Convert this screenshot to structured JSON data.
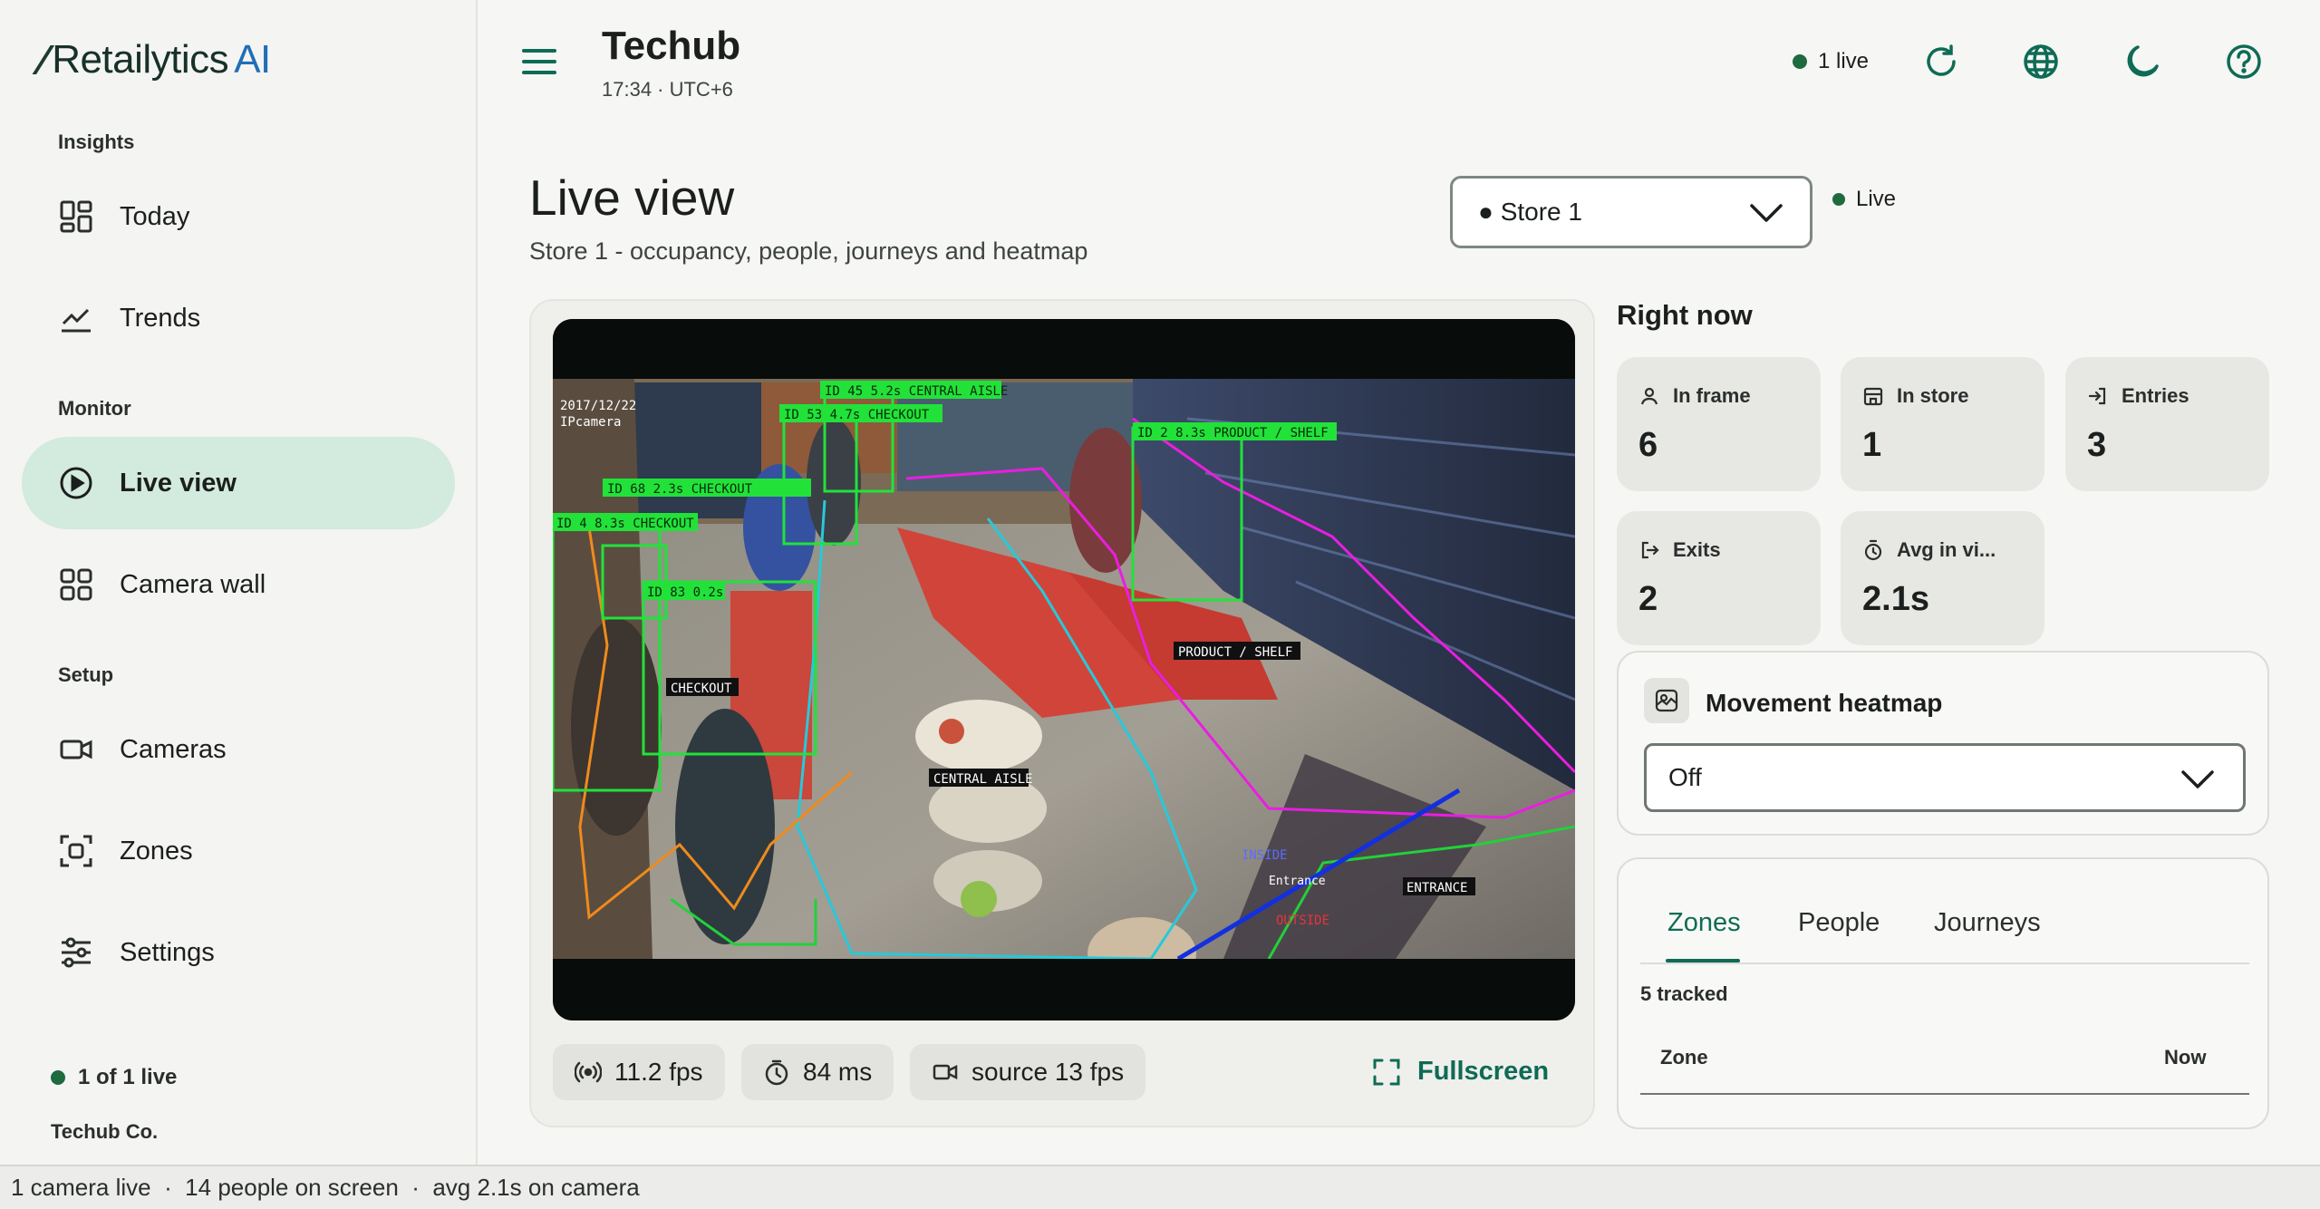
{
  "brand": {
    "name": "Retailytics",
    "suffix": "AI"
  },
  "sidebar": {
    "sections": [
      {
        "label": "Insights"
      },
      {
        "label": "Monitor"
      },
      {
        "label": "Setup"
      }
    ],
    "items": [
      {
        "label": "Today",
        "icon": "dashboard-icon"
      },
      {
        "label": "Trends",
        "icon": "trend-chart-icon"
      },
      {
        "label": "Live view",
        "icon": "play-circle-icon",
        "active": true
      },
      {
        "label": "Camera wall",
        "icon": "grid-icon"
      },
      {
        "label": "Cameras",
        "icon": "video-camera-icon"
      },
      {
        "label": "Zones",
        "icon": "zone-focus-icon"
      },
      {
        "label": "Settings",
        "icon": "sliders-icon"
      }
    ],
    "footer": {
      "live": "1 of 1 live",
      "company": "Techub Co."
    }
  },
  "header": {
    "title": "Techub",
    "subtitle": "17:34 · UTC+6",
    "live": "1 live",
    "actions": [
      "refresh-icon",
      "globe-icon",
      "moon-icon",
      "help-icon"
    ]
  },
  "page": {
    "title": "Live view",
    "subtitle": "Store 1 - occupancy, people, journeys and heatmap",
    "store_select": "● Store 1",
    "live": "Live"
  },
  "video": {
    "overlay": {
      "timestamp": "2017/12/22",
      "camera": "IPcamera",
      "boxes": [
        "ID 45  5.2s  CENTRAL AISLE",
        "ID 53  4.7s  CHECKOUT",
        "ID 2  8.3s  PRODUCT / SHELF",
        "ID 68  2.3s  CHECKOUT",
        "ID 4  8.3s  CHECKOUT",
        "ID 83  0.2s"
      ],
      "zones": [
        "PRODUCT / SHELF",
        "CHECKOUT",
        "CENTRAL AISLE",
        "ENTRANCE"
      ],
      "line_labels": {
        "inside": "INSIDE",
        "entrance": "Entrance",
        "outside": "OUTSIDE"
      }
    },
    "chips": [
      {
        "icon": "broadcast-icon",
        "label": "11.2 fps"
      },
      {
        "icon": "timer-icon",
        "label": "84 ms"
      },
      {
        "icon": "video-camera-icon",
        "label": "source 13 fps"
      }
    ],
    "fullscreen": "Fullscreen"
  },
  "right_now": {
    "title": "Right now",
    "stats": [
      {
        "label": "In frame",
        "value": "6",
        "icon": "person-icon"
      },
      {
        "label": "In store",
        "value": "1",
        "icon": "store-icon"
      },
      {
        "label": "Entries",
        "value": "3",
        "icon": "enter-icon"
      },
      {
        "label": "Exits",
        "value": "2",
        "icon": "exit-icon"
      },
      {
        "label": "Avg in vi...",
        "value": "2.1s",
        "icon": "stopwatch-icon"
      }
    ]
  },
  "heatmap": {
    "title": "Movement heatmap",
    "value": "Off"
  },
  "tabs": {
    "items": [
      "Zones",
      "People",
      "Journeys"
    ],
    "active": "Zones",
    "tracked": "5 tracked",
    "columns": [
      "Zone",
      "Now"
    ]
  },
  "statusbar": {
    "text": "1 camera live  ·  14 people on screen  ·  avg 2.1s on camera"
  },
  "colors": {
    "accent": "#0e6b55",
    "live": "#1d6b3f",
    "active_nav": "#d3eade"
  }
}
